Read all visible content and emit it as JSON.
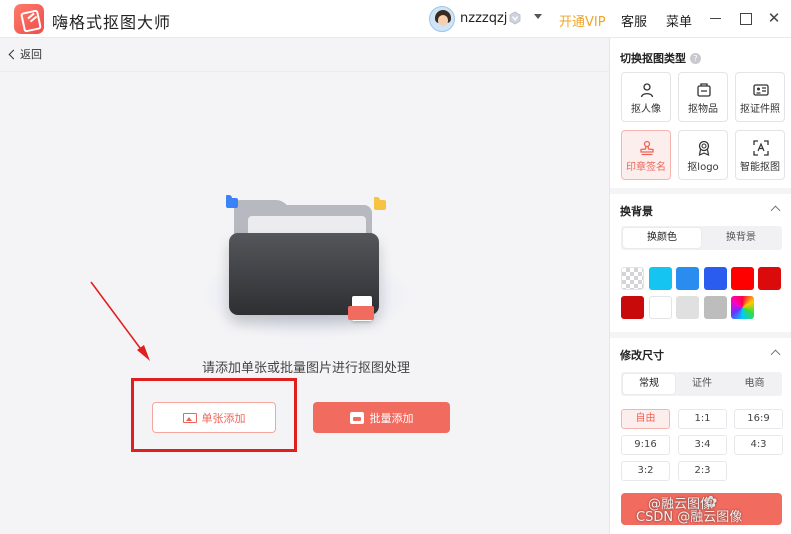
{
  "app": {
    "title": "嗨格式抠图大师"
  },
  "header": {
    "username": "nzzzqzj",
    "vip_link": "开通VIP",
    "service": "客服",
    "menu": "菜单",
    "close_glyph": "✕"
  },
  "toolbar": {
    "back": "返回"
  },
  "main": {
    "hint": "请添加单张或批量图片进行抠图处理",
    "single_add": "单张添加",
    "batch_add": "批量添加"
  },
  "panel": {
    "type_section": {
      "title": "切换抠图类型",
      "help_glyph": "?",
      "items": [
        {
          "label": "抠人像",
          "icon": "person-icon",
          "active": false
        },
        {
          "label": "抠物品",
          "icon": "box-icon",
          "active": false
        },
        {
          "label": "抠证件照",
          "icon": "id-card-icon",
          "active": false
        },
        {
          "label": "印章签名",
          "icon": "stamp-icon",
          "active": true
        },
        {
          "label": "抠logo",
          "icon": "badge-icon",
          "active": false
        },
        {
          "label": "智能抠图",
          "icon": "smart-crop-icon",
          "active": false
        }
      ]
    },
    "background_section": {
      "title": "换背景",
      "tabs": [
        "换颜色",
        "换背景"
      ],
      "active_tab": 0,
      "swatches": [
        "transparent",
        "#15c4f1",
        "#2b8cf0",
        "#2a5cf0",
        "#ff0000",
        "#dc0b0b",
        "#c80a0a",
        "#ffffff",
        "#e0e0e0",
        "#bdbdbd",
        "rainbow"
      ]
    },
    "size_section": {
      "title": "修改尺寸",
      "tabs": [
        "常规",
        "证件",
        "电商"
      ],
      "active_tab": 0,
      "options": [
        "自由",
        "1:1",
        "16:9",
        "9:16",
        "3:4",
        "4:3",
        "3:2",
        "2:3"
      ],
      "active_option": 0
    }
  },
  "watermark": {
    "line1": "@融云图像",
    "line2": "CSDN @融云图像",
    "logo_glyph": "✿"
  },
  "colors": {
    "accent": "#f26b5f",
    "vip": "#f0a52a",
    "annotation": "#e0201f"
  }
}
